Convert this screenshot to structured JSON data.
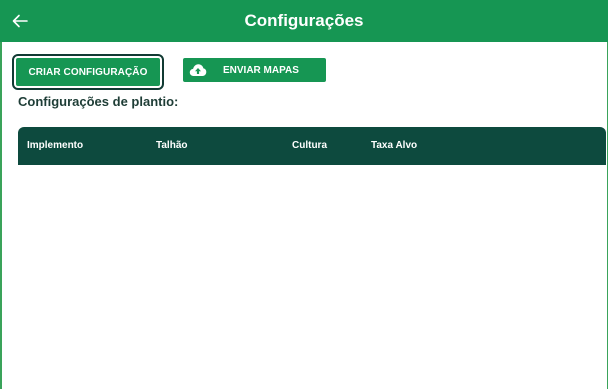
{
  "appbar": {
    "title": "Configurações",
    "back_icon": "arrow-left-icon"
  },
  "toolbar": {
    "create_label": "CRIAR CONFIGURAÇÃO",
    "send_label": "ENVIAR MAPAS",
    "send_icon": "cloud-upload-icon"
  },
  "section": {
    "title": "Configurações de plantio:"
  },
  "table": {
    "columns": [
      "Implemento",
      "Talhão",
      "Cultura",
      "Taxa Alvo"
    ],
    "rows": []
  },
  "colors": {
    "primary": "#169653",
    "dark": "#0d4a3e",
    "outline": "#113a33"
  }
}
